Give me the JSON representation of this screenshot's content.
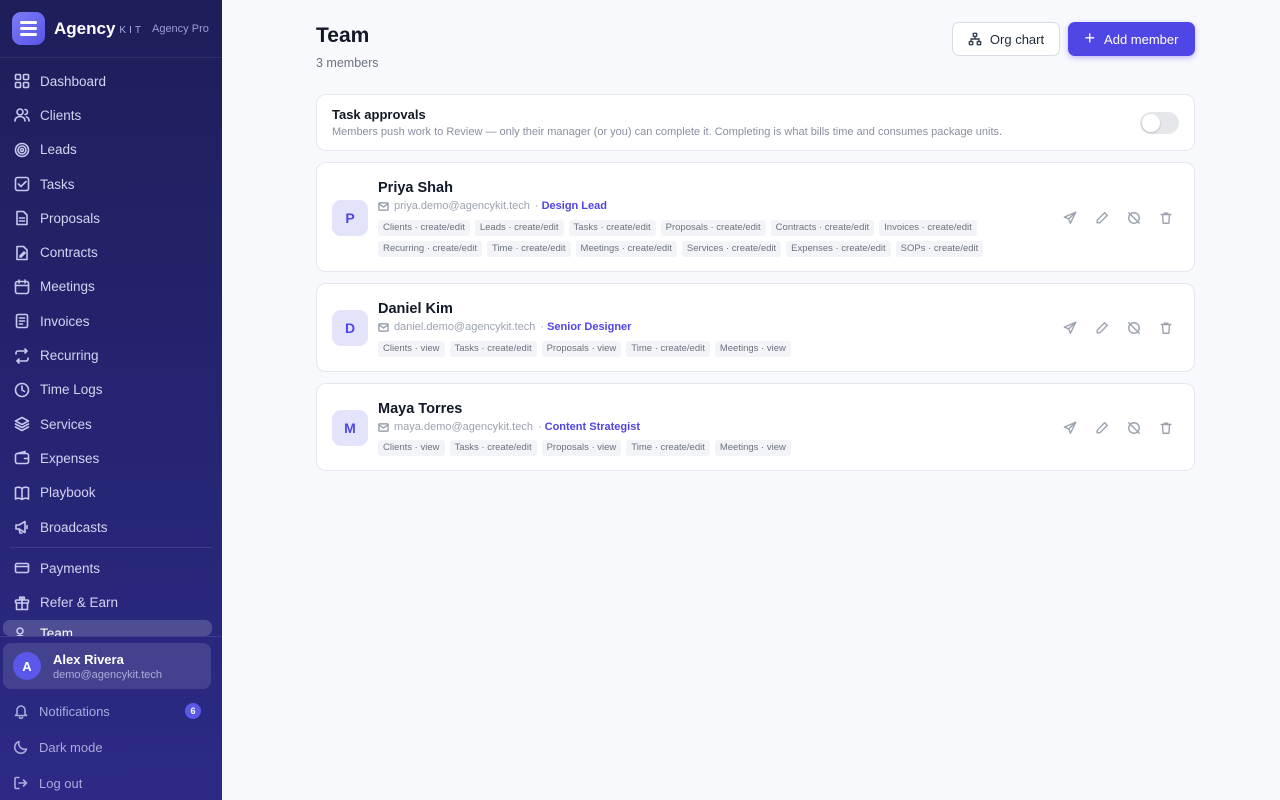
{
  "brand": {
    "name": "Agency",
    "kit": "KIT",
    "plan": "Agency Pro"
  },
  "nav": [
    {
      "label": "Dashboard",
      "icon": "grid-icon"
    },
    {
      "label": "Clients",
      "icon": "users-icon"
    },
    {
      "label": "Leads",
      "icon": "target-icon"
    },
    {
      "label": "Tasks",
      "icon": "checkbox-icon"
    },
    {
      "label": "Proposals",
      "icon": "document-icon"
    },
    {
      "label": "Contracts",
      "icon": "contract-icon"
    },
    {
      "label": "Meetings",
      "icon": "calendar-icon"
    },
    {
      "label": "Invoices",
      "icon": "invoice-icon"
    },
    {
      "label": "Recurring",
      "icon": "repeat-icon"
    },
    {
      "label": "Time Logs",
      "icon": "clock-icon"
    },
    {
      "label": "Services",
      "icon": "layers-icon"
    },
    {
      "label": "Expenses",
      "icon": "wallet-icon"
    },
    {
      "label": "Playbook",
      "icon": "book-icon"
    },
    {
      "label": "Broadcasts",
      "icon": "megaphone-icon"
    }
  ],
  "nav2": [
    {
      "label": "Payments",
      "icon": "card-icon"
    },
    {
      "label": "Refer & Earn",
      "icon": "gift-icon"
    },
    {
      "label": "Team",
      "icon": "team-icon"
    }
  ],
  "user": {
    "initial": "A",
    "name": "Alex Rivera",
    "email": "demo@agencykit.tech"
  },
  "bottom": {
    "notifications": "Notifications",
    "notif_count": "6",
    "dark_mode": "Dark mode",
    "logout": "Log out"
  },
  "page": {
    "title": "Team",
    "subtitle": "3 members",
    "org_chart": "Org chart",
    "add_member": "Add member"
  },
  "approvals": {
    "title": "Task approvals",
    "description": "Members push work to Review — only their manager (or you) can complete it. Completing is what bills time and consumes package units.",
    "enabled": false
  },
  "members": [
    {
      "initial": "P",
      "name": "Priya Shah",
      "email": "priya.demo@agencykit.tech",
      "role": "Design Lead",
      "permissions": [
        "Clients · create/edit",
        "Leads · create/edit",
        "Tasks · create/edit",
        "Proposals · create/edit",
        "Contracts · create/edit",
        "Invoices · create/edit",
        "Recurring · create/edit",
        "Time · create/edit",
        "Meetings · create/edit",
        "Services · create/edit",
        "Expenses · create/edit",
        "SOPs · create/edit"
      ]
    },
    {
      "initial": "D",
      "name": "Daniel Kim",
      "email": "daniel.demo@agencykit.tech",
      "role": "Senior Designer",
      "permissions": [
        "Clients · view",
        "Tasks · create/edit",
        "Proposals · view",
        "Time · create/edit",
        "Meetings · view"
      ]
    },
    {
      "initial": "M",
      "name": "Maya Torres",
      "email": "maya.demo@agencykit.tech",
      "role": "Content Strategist",
      "permissions": [
        "Clients · view",
        "Tasks · create/edit",
        "Proposals · view",
        "Time · create/edit",
        "Meetings · view"
      ]
    }
  ],
  "colors": {
    "accent": "#4f46e5",
    "sidebar_top": "#1e1e5a",
    "sidebar_bottom": "#2c2a86"
  }
}
